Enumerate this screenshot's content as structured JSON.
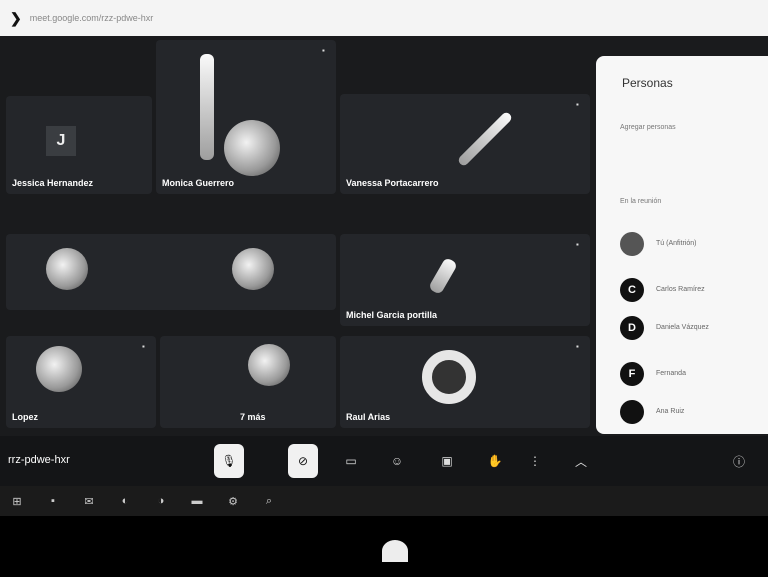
{
  "browser": {
    "url": "meet.google.com/rzz-pdwe-hxr"
  },
  "tiles": [
    {
      "name": "Jessica Hernandez",
      "initial": "J"
    },
    {
      "name": "Monica Guerrero"
    },
    {
      "name": "Vanessa Portacarrero"
    },
    {
      "name": ""
    },
    {
      "name": "Michel Garcia portilla"
    },
    {
      "name": "Lopez"
    },
    {
      "name": "7 más"
    },
    {
      "name": "Raul Arias"
    }
  ],
  "panel": {
    "title": "Personas",
    "add_label": "Agregar personas",
    "section_label": "En la reunión",
    "people": [
      {
        "initial": "",
        "name": "Tú (Anfitrión)"
      },
      {
        "initial": "C",
        "name": "Carlos Ramírez"
      },
      {
        "initial": "D",
        "name": "Daniela Vázquez"
      },
      {
        "initial": "F",
        "name": "Fernanda"
      },
      {
        "initial": "",
        "name": "Ana Ruiz"
      }
    ]
  },
  "meeting_code": "rrz-pdwe-hxr"
}
